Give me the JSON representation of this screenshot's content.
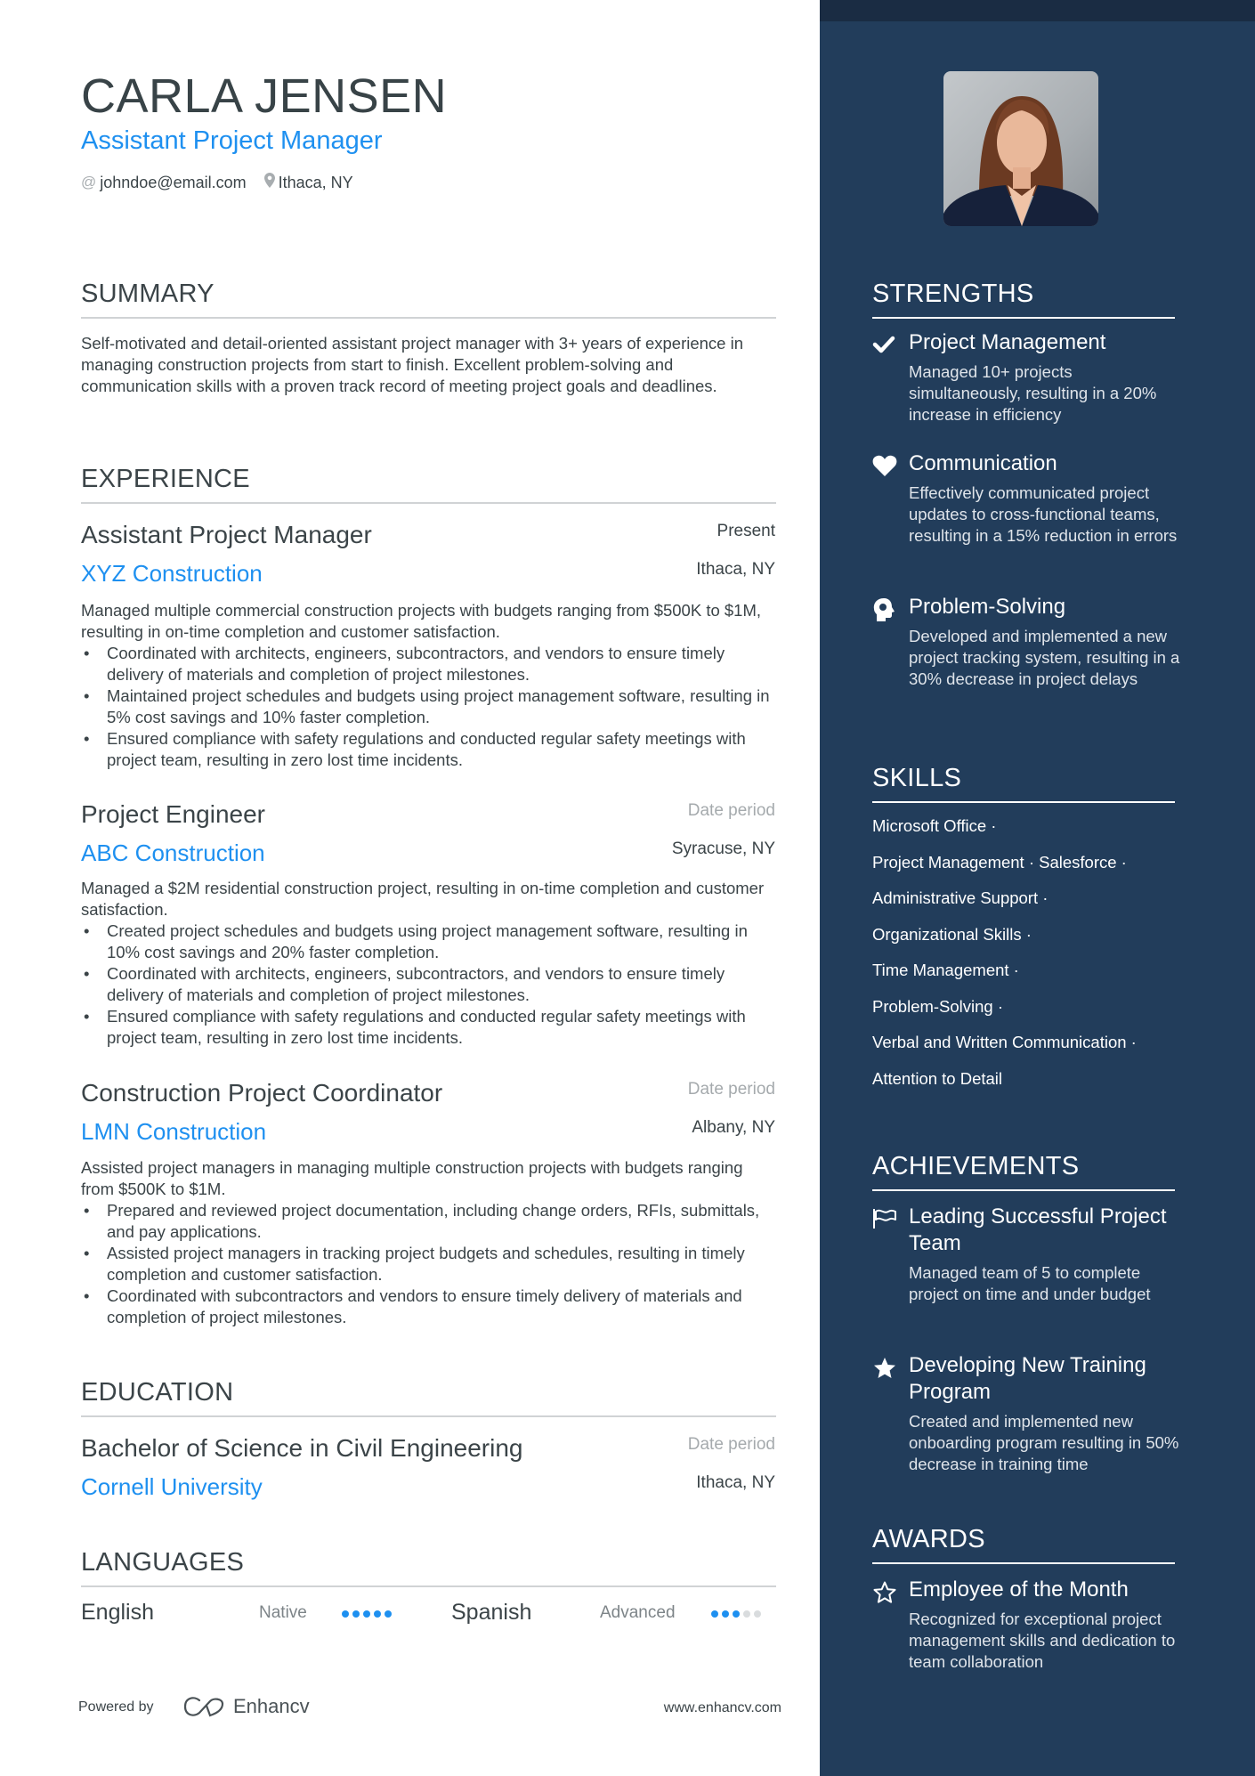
{
  "header": {
    "name": "CARLA JENSEN",
    "title": "Assistant Project Manager",
    "email": "johndoe@email.com",
    "location": "Ithaca, NY",
    "email_icon": "at-icon",
    "location_icon": "map-pin-icon"
  },
  "colors": {
    "accent": "#1e90f0",
    "sidebar_bg": "#223d5b",
    "sidebar_topbar": "#1a2c43",
    "text": "#3b4448"
  },
  "summary": {
    "heading": "SUMMARY",
    "text": "Self-motivated and detail-oriented assistant project manager with 3+ years of experience in managing construction projects from start to finish. Excellent problem-solving and communication skills with a proven track record of meeting project goals and deadlines."
  },
  "experience": {
    "heading": "EXPERIENCE",
    "jobs": [
      {
        "title": "Assistant Project Manager",
        "company": "XYZ Construction",
        "date": "Present",
        "location": "Ithaca, NY",
        "description": "Managed multiple commercial construction projects with budgets ranging from $500K to $1M, resulting in on-time completion and customer satisfaction.",
        "bullets": [
          "Coordinated with architects, engineers, subcontractors, and vendors to ensure timely delivery of materials and completion of project milestones.",
          "Maintained project schedules and budgets using project management software, resulting in 5% cost savings and 10% faster completion.",
          "Ensured compliance with safety regulations and conducted regular safety meetings with project team, resulting in zero lost time incidents."
        ]
      },
      {
        "title": "Project Engineer",
        "company": "ABC Construction",
        "date": "Date period",
        "location": "Syracuse, NY",
        "description": "Managed a $2M residential construction project, resulting in on-time completion and customer satisfaction.",
        "bullets": [
          "Created project schedules and budgets using project management software, resulting in 10% cost savings and 20% faster completion.",
          "Coordinated with architects, engineers, subcontractors, and vendors to ensure timely delivery of materials and completion of project milestones.",
          "Ensured compliance with safety regulations and conducted regular safety meetings with project team, resulting in zero lost time incidents."
        ]
      },
      {
        "title": "Construction Project Coordinator",
        "company": "LMN Construction",
        "date": "Date period",
        "location": "Albany, NY",
        "description": "Assisted project managers in managing multiple construction projects with budgets ranging from $500K to $1M.",
        "bullets": [
          "Prepared and reviewed project documentation, including change orders, RFIs, submittals, and pay applications.",
          "Assisted project managers in tracking project budgets and schedules, resulting in timely completion and customer satisfaction.",
          "Coordinated with subcontractors and vendors to ensure timely delivery of materials and completion of project milestones."
        ]
      }
    ]
  },
  "education": {
    "heading": "EDUCATION",
    "items": [
      {
        "degree": "Bachelor of Science in Civil Engineering",
        "school": "Cornell University",
        "date": "Date period",
        "location": "Ithaca, NY"
      }
    ]
  },
  "languages": {
    "heading": "LANGUAGES",
    "items": [
      {
        "name": "English",
        "level": "Native",
        "dots_filled": 5,
        "dots_total": 5
      },
      {
        "name": "Spanish",
        "level": "Advanced",
        "dots_filled": 3,
        "dots_total": 5
      }
    ]
  },
  "footer": {
    "powered_by": "Powered by",
    "brand": "Enhancv",
    "url": "www.enhancv.com"
  },
  "strengths": {
    "heading": "STRENGTHS",
    "items": [
      {
        "icon": "checkmark-icon",
        "title": "Project Management",
        "description": "Managed 10+ projects simultaneously, resulting in a 20% increase in efficiency"
      },
      {
        "icon": "heart-icon",
        "title": "Communication",
        "description": "Effectively communicated project updates to cross-functional teams, resulting in a 15% reduction in errors"
      },
      {
        "icon": "head-brain-icon",
        "title": "Problem-Solving",
        "description": "Developed and implemented a new project tracking system, resulting in a 30% decrease in project delays"
      }
    ]
  },
  "skills": {
    "heading": "SKILLS",
    "lines": [
      "Microsoft Office ·",
      "Project Management · Salesforce ·",
      "Administrative Support ·",
      "Organizational Skills ·",
      "Time Management ·",
      "Problem-Solving ·",
      "Verbal and Written Communication ·",
      "Attention to Detail"
    ]
  },
  "achievements": {
    "heading": "ACHIEVEMENTS",
    "items": [
      {
        "icon": "flag-icon",
        "title": "Leading Successful Project Team",
        "description": "Managed team of 5 to complete project on time and under budget"
      },
      {
        "icon": "star-filled-icon",
        "title": "Developing New Training Program",
        "description": "Created and implemented new onboarding program resulting in 50% decrease in training time"
      }
    ]
  },
  "awards": {
    "heading": "AWARDS",
    "items": [
      {
        "icon": "star-outline-icon",
        "title": "Employee of the Month",
        "description": "Recognized for exceptional project management skills and dedication to team collaboration"
      }
    ]
  }
}
